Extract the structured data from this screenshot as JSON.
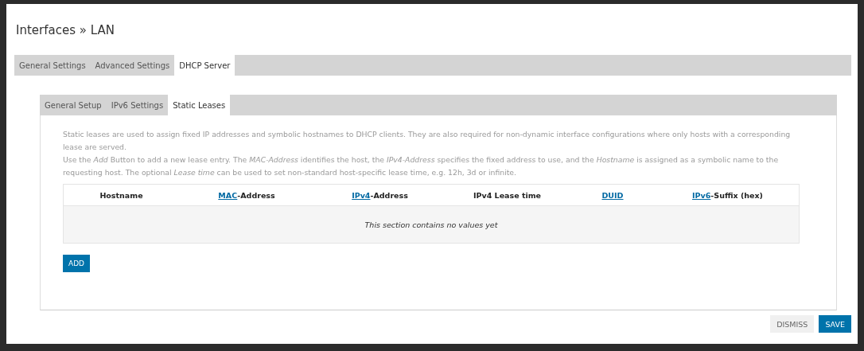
{
  "dialog": {
    "title": "Interfaces » LAN"
  },
  "tabs": [
    {
      "label": "General Settings",
      "selected": false
    },
    {
      "label": "Advanced Settings",
      "selected": false
    },
    {
      "label": "DHCP Server",
      "selected": true
    }
  ],
  "subtabs": [
    {
      "label": "General Setup",
      "selected": false
    },
    {
      "label": "IPv6 Settings",
      "selected": false
    },
    {
      "label": "Static Leases",
      "selected": true
    }
  ],
  "description": [
    "Static leases are used to assign fixed IP addresses and symbolic hostnames to DHCP clients. They are also required for non-dynamic interface configurations where only hosts with a corresponding lease are served.",
    "Use the *Add* Button to add a new lease entry. The *MAC-Address* identifies the host, the *IPv4-Address* specifies the fixed address to use, and the *Hostname* is assigned as a symbolic name to the requesting host. The optional *Lease time* can be used to set non-standard host-specific lease time, e.g. 12h, 3d or infinite."
  ],
  "table": {
    "columns": [
      {
        "text": "Hostname"
      },
      {
        "link": "MAC",
        "text": "-Address"
      },
      {
        "link": "IPv4",
        "text": "-Address"
      },
      {
        "text": "IPv4 Lease time"
      },
      {
        "link": "DUID"
      },
      {
        "link": "IPv6",
        "text": "-Suffix (hex)"
      }
    ],
    "empty_message": "This section contains no values yet"
  },
  "add_button": "ADD",
  "footer_buttons": [
    {
      "label": "DISMISS",
      "kind": "plain"
    },
    {
      "label": "SAVE",
      "kind": "primary"
    }
  ]
}
